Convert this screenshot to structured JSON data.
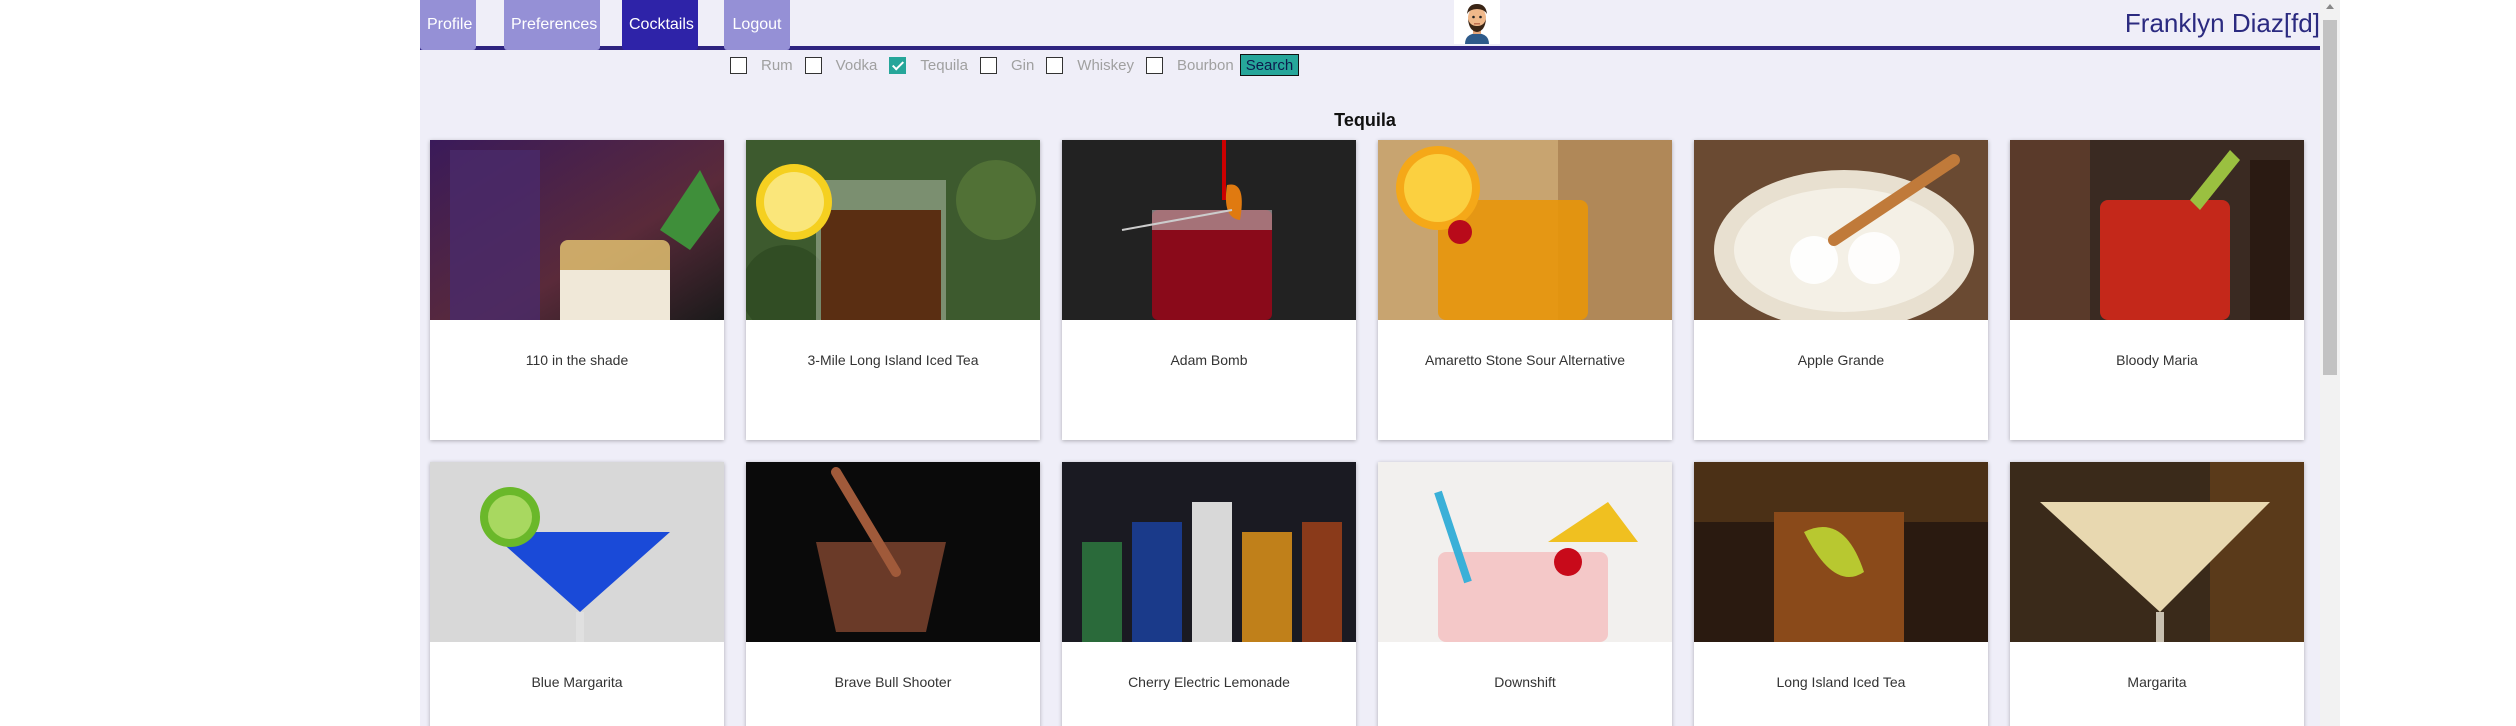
{
  "nav": {
    "tabs": [
      {
        "label": "Profile",
        "active": false
      },
      {
        "label": "Preferences",
        "active": false
      },
      {
        "label": "Cocktails",
        "active": true
      },
      {
        "label": "Logout",
        "active": false
      }
    ],
    "user_name": "Franklyn Diaz[fd]",
    "avatar_icon": "bearded-man-avatar"
  },
  "filters": {
    "options": [
      {
        "label": "Rum",
        "checked": false
      },
      {
        "label": "Vodka",
        "checked": false
      },
      {
        "label": "Tequila",
        "checked": true
      },
      {
        "label": "Gin",
        "checked": false
      },
      {
        "label": "Whiskey",
        "checked": false
      },
      {
        "label": "Bourbon",
        "checked": false
      }
    ],
    "search_label": "Search"
  },
  "section_title": "Tequila",
  "cocktails": [
    {
      "name": "110 in the shade",
      "image": "whisky-glass-mint-dark-bar"
    },
    {
      "name": "3-Mile Long Island Iced Tea",
      "image": "iced-tea-lemon-green-bg"
    },
    {
      "name": "Adam Bomb",
      "image": "red-drink-orange-peel"
    },
    {
      "name": "Amaretto Stone Sour Alternative",
      "image": "orange-drink-cherry"
    },
    {
      "name": "Apple Grande",
      "image": "salt-rim-ice-cinnamon"
    },
    {
      "name": "Bloody Maria",
      "image": "red-drink-celery"
    },
    {
      "name": "Blue Margarita",
      "image": "blue-margarita-lime"
    },
    {
      "name": "Brave Bull Shooter",
      "image": "shot-glass-pour"
    },
    {
      "name": "Cherry Electric Lemonade",
      "image": "liquor-bottles"
    },
    {
      "name": "Downshift",
      "image": "pink-drink-pineapple-straw"
    },
    {
      "name": "Long Island Iced Tea",
      "image": "bar-iced-tea-lemon"
    },
    {
      "name": "Margarita",
      "image": "martini-glass-cream"
    }
  ],
  "colors": {
    "accent": "#2e23a8",
    "tab_inactive": "#9590d6",
    "page_bg": "#efeef8",
    "search_button": "#26a69a"
  }
}
